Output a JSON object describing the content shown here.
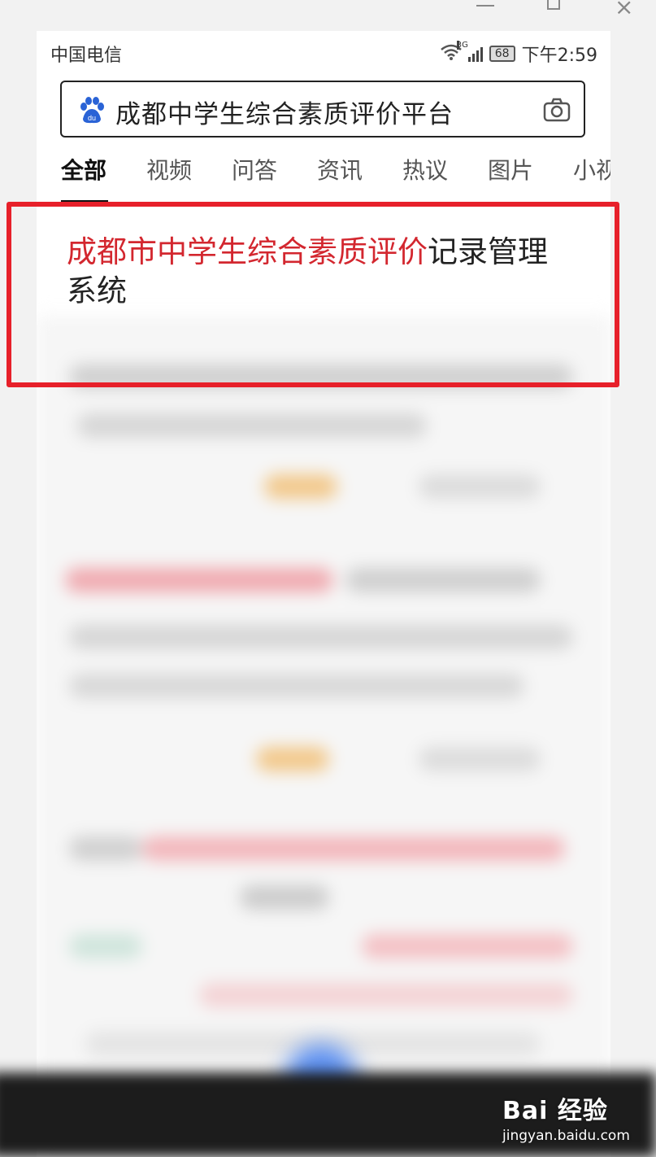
{
  "status_bar": {
    "carrier": "中国电信",
    "network": "3G",
    "battery": "68",
    "time": "下午2:59"
  },
  "search": {
    "query": "成都中学生综合素质评价平台",
    "logo_icon": "baidu-paw-icon",
    "camera_icon": "camera-icon"
  },
  "tabs": [
    {
      "label": "全部",
      "active": true
    },
    {
      "label": "视频"
    },
    {
      "label": "问答"
    },
    {
      "label": "资讯"
    },
    {
      "label": "热议"
    },
    {
      "label": "图片"
    },
    {
      "label": "小视"
    }
  ],
  "result": {
    "title_highlight": "成都市中学生综合素质评价",
    "title_rest_line1": "记录管理",
    "title_rest_line2": "系统"
  },
  "watermark": {
    "brand": "Bai 经验",
    "url": "jingyan.baidu.com"
  },
  "colors": {
    "highlight_red": "#d3272f",
    "frame_red": "#e7202a",
    "baidu_blue": "#2a63d6"
  }
}
